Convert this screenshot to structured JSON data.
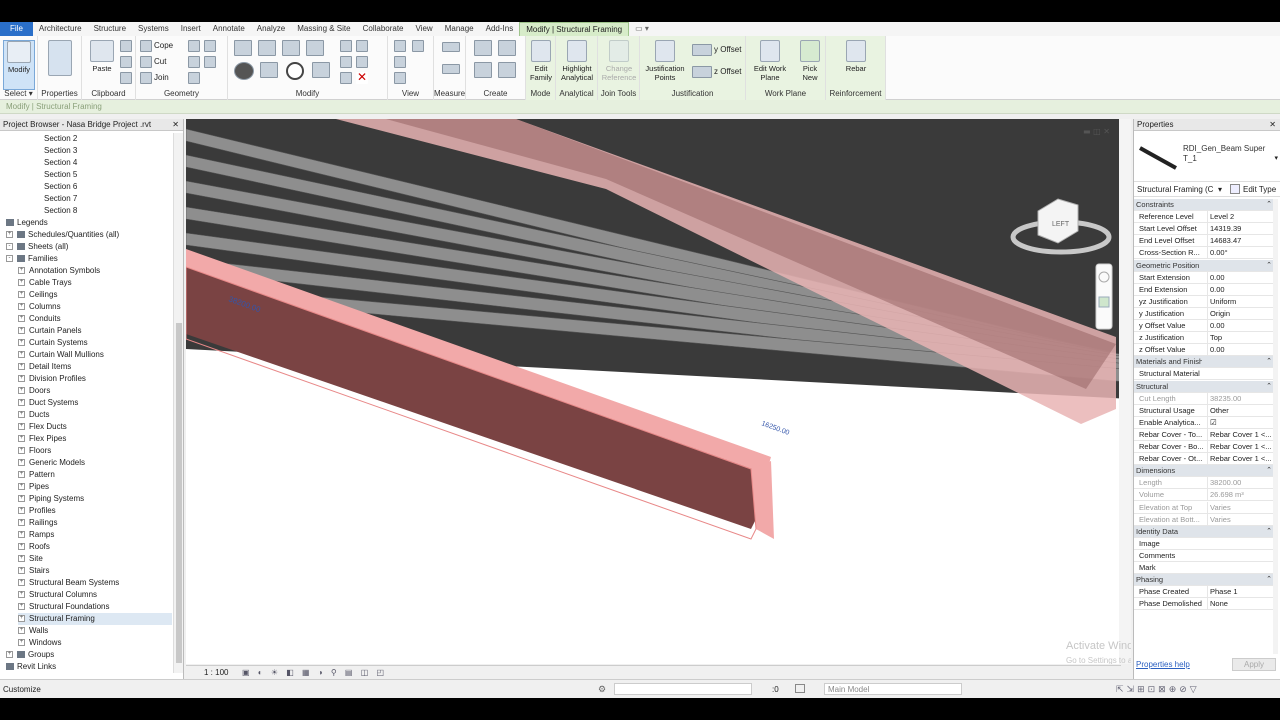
{
  "tabs": [
    "File",
    "Architecture",
    "Structure",
    "Systems",
    "Insert",
    "Annotate",
    "Analyze",
    "Massing & Site",
    "Collaborate",
    "View",
    "Manage",
    "Add-Ins",
    "Modify | Structural Framing"
  ],
  "ribbon": {
    "select_label": "Select ▾",
    "modify_label": "Modify",
    "properties_label": "Properties",
    "paste_label": "Paste",
    "clipboard_label": "Clipboard",
    "cope_label": "Cope",
    "cut_label": "Cut",
    "join_label": "Join",
    "geometry_label": "Geometry",
    "modify_panel_label": "Modify",
    "view_label": "View",
    "measure_label": "Measure",
    "create_label": "Create",
    "edit_family_label": "Edit Family",
    "mode_label": "Mode",
    "highlight_analytical_label": "Highlight Analytical",
    "analytical_label": "Analytical",
    "change_reference_label": "Change Reference",
    "join_tools_label": "Join Tools",
    "justification_points_label": "Justification Points",
    "y_offset_label": "y Offset",
    "z_offset_label": "z Offset",
    "justification_label": "Justification",
    "edit_work_plane_label": "Edit Work Plane",
    "pick_new_label": "Pick New",
    "work_plane_label": "Work Plane",
    "rebar_label": "Rebar",
    "reinforcement_label": "Reinforcement"
  },
  "context_bar": "Modify | Structural Framing",
  "project_browser": {
    "title": "Project Browser - Nasa Bridge Project .rvt",
    "items": [
      {
        "label": "Section 2",
        "level": 3,
        "exp": ""
      },
      {
        "label": "Section 3",
        "level": 3,
        "exp": ""
      },
      {
        "label": "Section 4",
        "level": 3,
        "exp": ""
      },
      {
        "label": "Section 5",
        "level": 3,
        "exp": ""
      },
      {
        "label": "Section 6",
        "level": 3,
        "exp": ""
      },
      {
        "label": "Section 7",
        "level": 3,
        "exp": ""
      },
      {
        "label": "Section 8",
        "level": 3,
        "exp": ""
      },
      {
        "label": "Legends",
        "level": 1,
        "exp": ""
      },
      {
        "label": "Schedules/Quantities (all)",
        "level": 1,
        "exp": "+"
      },
      {
        "label": "Sheets (all)",
        "level": 1,
        "exp": "-"
      },
      {
        "label": "Families",
        "level": 1,
        "exp": "-"
      },
      {
        "label": "Annotation Symbols",
        "level": 2,
        "exp": "+"
      },
      {
        "label": "Cable Trays",
        "level": 2,
        "exp": "+"
      },
      {
        "label": "Ceilings",
        "level": 2,
        "exp": "+"
      },
      {
        "label": "Columns",
        "level": 2,
        "exp": "+"
      },
      {
        "label": "Conduits",
        "level": 2,
        "exp": "+"
      },
      {
        "label": "Curtain Panels",
        "level": 2,
        "exp": "+"
      },
      {
        "label": "Curtain Systems",
        "level": 2,
        "exp": "+"
      },
      {
        "label": "Curtain Wall Mullions",
        "level": 2,
        "exp": "+"
      },
      {
        "label": "Detail Items",
        "level": 2,
        "exp": "+"
      },
      {
        "label": "Division Profiles",
        "level": 2,
        "exp": "+"
      },
      {
        "label": "Doors",
        "level": 2,
        "exp": "+"
      },
      {
        "label": "Duct Systems",
        "level": 2,
        "exp": "+"
      },
      {
        "label": "Ducts",
        "level": 2,
        "exp": "+"
      },
      {
        "label": "Flex Ducts",
        "level": 2,
        "exp": "+"
      },
      {
        "label": "Flex Pipes",
        "level": 2,
        "exp": "+"
      },
      {
        "label": "Floors",
        "level": 2,
        "exp": "+"
      },
      {
        "label": "Generic Models",
        "level": 2,
        "exp": "+"
      },
      {
        "label": "Pattern",
        "level": 2,
        "exp": "+"
      },
      {
        "label": "Pipes",
        "level": 2,
        "exp": "+"
      },
      {
        "label": "Piping Systems",
        "level": 2,
        "exp": "+"
      },
      {
        "label": "Profiles",
        "level": 2,
        "exp": "+"
      },
      {
        "label": "Railings",
        "level": 2,
        "exp": "+"
      },
      {
        "label": "Ramps",
        "level": 2,
        "exp": "+"
      },
      {
        "label": "Roofs",
        "level": 2,
        "exp": "+"
      },
      {
        "label": "Site",
        "level": 2,
        "exp": "+"
      },
      {
        "label": "Stairs",
        "level": 2,
        "exp": "+"
      },
      {
        "label": "Structural Beam Systems",
        "level": 2,
        "exp": "+"
      },
      {
        "label": "Structural Columns",
        "level": 2,
        "exp": "+"
      },
      {
        "label": "Structural Foundations",
        "level": 2,
        "exp": "+"
      },
      {
        "label": "Structural Framing",
        "level": 2,
        "exp": "+",
        "highlight": true
      },
      {
        "label": "Walls",
        "level": 2,
        "exp": "+"
      },
      {
        "label": "Windows",
        "level": 2,
        "exp": "+"
      },
      {
        "label": "Groups",
        "level": 1,
        "exp": "+"
      },
      {
        "label": "Revit Links",
        "level": 1,
        "exp": ""
      }
    ]
  },
  "canvas": {
    "dim_label_1": "38200.00",
    "dim_label_2": "16250.00",
    "viewcube_label": "LEFT"
  },
  "view_bar": {
    "scale": "1 : 100"
  },
  "properties": {
    "title": "Properties",
    "type_name": "RDI_Gen_Beam Super T_1",
    "filter": "Structural Framing (C",
    "edit_type": "Edit Type",
    "rows": [
      {
        "k": "Constraints",
        "grp": true
      },
      {
        "k": "Reference Level",
        "v": "Level 2"
      },
      {
        "k": "Start Level Offset",
        "v": "14319.39"
      },
      {
        "k": "End Level Offset",
        "v": "14683.47"
      },
      {
        "k": "Cross-Section R...",
        "v": "0.00°"
      },
      {
        "k": "Geometric Position",
        "grp": true
      },
      {
        "k": "Start Extension",
        "v": "0.00"
      },
      {
        "k": "End Extension",
        "v": "0.00"
      },
      {
        "k": "yz Justification",
        "v": "Uniform"
      },
      {
        "k": "y Justification",
        "v": "Origin"
      },
      {
        "k": "y Offset Value",
        "v": "0.00"
      },
      {
        "k": "z Justification",
        "v": "Top"
      },
      {
        "k": "z Offset Value",
        "v": "0.00"
      },
      {
        "k": "Materials and Finishes",
        "grp": true
      },
      {
        "k": "Structural Material",
        "v": ""
      },
      {
        "k": "Structural",
        "grp": true
      },
      {
        "k": "Cut Length",
        "v": "38235.00",
        "grey": true
      },
      {
        "k": "Structural Usage",
        "v": "Other"
      },
      {
        "k": "Enable Analytica...",
        "v": "☑"
      },
      {
        "k": "Rebar Cover - To...",
        "v": "Rebar Cover 1 <..."
      },
      {
        "k": "Rebar Cover - Bo...",
        "v": "Rebar Cover 1 <..."
      },
      {
        "k": "Rebar Cover - Ot...",
        "v": "Rebar Cover 1 <..."
      },
      {
        "k": "Dimensions",
        "grp": true
      },
      {
        "k": "Length",
        "v": "38200.00",
        "grey": true
      },
      {
        "k": "Volume",
        "v": "26.698 m³",
        "grey": true
      },
      {
        "k": "Elevation at Top",
        "v": "Varies",
        "grey": true
      },
      {
        "k": "Elevation at Bott...",
        "v": "Varies",
        "grey": true
      },
      {
        "k": "Identity Data",
        "grp": true
      },
      {
        "k": "Image",
        "v": ""
      },
      {
        "k": "Comments",
        "v": ""
      },
      {
        "k": "Mark",
        "v": ""
      },
      {
        "k": "Phasing",
        "grp": true
      },
      {
        "k": "Phase Created",
        "v": "Phase 1"
      },
      {
        "k": "Phase Demolished",
        "v": "None"
      }
    ],
    "help_link": "Properties help",
    "apply": "Apply"
  },
  "watermark": {
    "line1": "Activate Windows",
    "line2": "Go to Settings to activate Windows."
  },
  "status": {
    "left": "Customize",
    "zero": ":0",
    "model": "Main Model"
  }
}
